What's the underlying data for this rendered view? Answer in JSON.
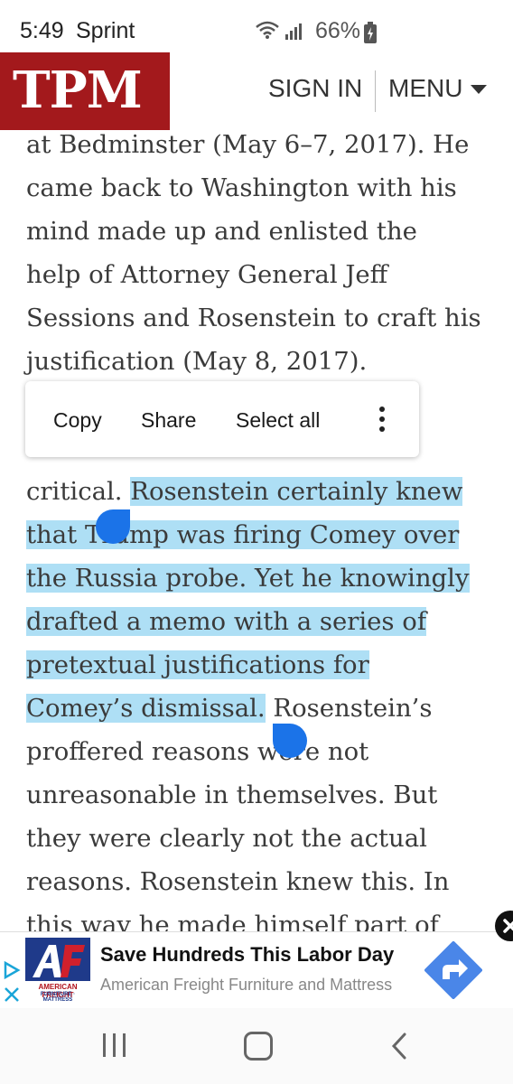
{
  "status_bar": {
    "time": "5:49",
    "carrier": "Sprint",
    "battery_percent": "66%",
    "icons": [
      "wifi-icon",
      "signal-icon",
      "battery-charging-icon"
    ]
  },
  "header": {
    "logo": "TPM",
    "sign_in": "SIGN IN",
    "menu": "MENU",
    "brand_color": "#a3191c"
  },
  "article": {
    "lines": [
      "at Bedminster (May 6–7, 2017). He",
      "came back to Washington with his",
      "mind made up and enlisted the",
      "help of Attorney General Jeff",
      "Sessions and Rosenstein to craft his",
      "justification (May 8, 2017)."
    ],
    "partial_line_before": "critical.",
    "selected_lines": [
      "Rosenstein certainly knew",
      "that Trump was firing Comey over",
      "the Russia probe. Yet he knowingly",
      "drafted a memo with a series of",
      "pretextual justifications for",
      "Comey’s dismissal."
    ],
    "partial_line_after": "Rosenstein’s",
    "lines_after": [
      "proffered reasons were not",
      "unreasonable in themselves. But",
      "they were clearly not the actual",
      "reasons. Rosenstein knew this. In",
      "this way he made himself part of"
    ],
    "selection_color": "#aedff5"
  },
  "selection_menu": {
    "copy": "Copy",
    "share": "Share",
    "select_all": "Select all",
    "more_icon": "more-vertical-icon"
  },
  "ad": {
    "logo_text": "AMERICAN FREIGHT",
    "logo_subtext": "FURNITURE · MATTRESS",
    "headline": "Save Hundreds This Labor Day",
    "advertiser": "American Freight Furniture and Mattress",
    "cta_color": "#4a86e8"
  },
  "nav_bar": {
    "icons": [
      "recent-apps-icon",
      "home-icon",
      "back-icon"
    ]
  }
}
